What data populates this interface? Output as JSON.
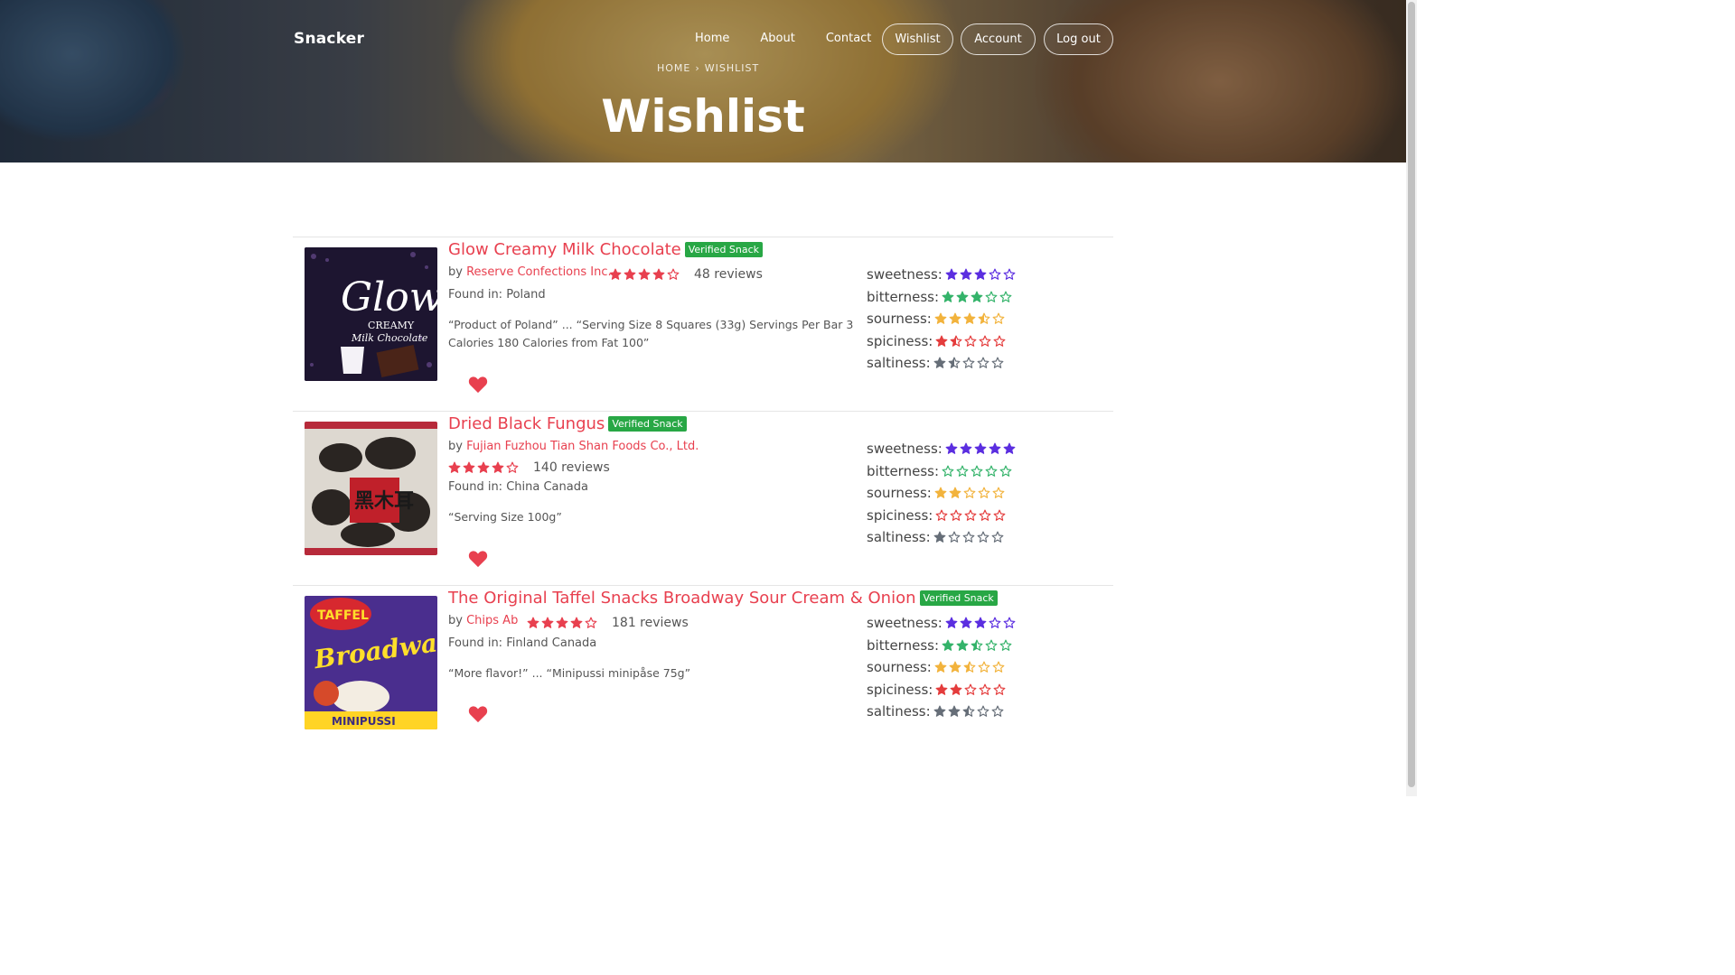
{
  "header": {
    "brand": "Snacker",
    "nav": [
      {
        "label": "Home"
      },
      {
        "label": "About"
      },
      {
        "label": "Contact"
      }
    ],
    "buttons": [
      {
        "label": "Wishlist"
      },
      {
        "label": "Account"
      },
      {
        "label": "Log out"
      }
    ],
    "breadcrumb": {
      "home": "HOME",
      "separator": "›",
      "current": "WISHLIST"
    },
    "title": "Wishlist"
  },
  "colors": {
    "accent": "#e8404f",
    "verified": "#28a745",
    "sweetness": "#5b2ee0",
    "bitterness": "#34b36a",
    "sourness": "#f2b33d",
    "spiciness": "#e43d3d",
    "saltiness": "#666e78"
  },
  "items": [
    {
      "title": "Glow Creamy Milk Chocolate",
      "badge": "Verified Snack",
      "by_prefix": "by",
      "maker": "Reserve Confections Inc.",
      "rating": 4,
      "reviews": "48 reviews",
      "found": "Found in: Poland",
      "description": "“Product of Poland” ... “Serving Size 8 Squares (33g) Servings Per Bar 3 Calories 180 Calories from Fat 100”",
      "heart_icon": "heart-icon",
      "attributes": [
        {
          "label": "sweetness:",
          "value": 3
        },
        {
          "label": "bitterness:",
          "value": 3
        },
        {
          "label": "sourness:",
          "value": 3.5
        },
        {
          "label": "spiciness:",
          "value": 1.5
        },
        {
          "label": "saltiness:",
          "value": 1.5
        }
      ]
    },
    {
      "title": "Dried Black Fungus",
      "badge": "Verified Snack",
      "by_prefix": "by",
      "maker": "Fujian Fuzhou Tian Shan Foods Co., Ltd.",
      "rating": 4,
      "reviews": "140 reviews",
      "found": "Found in: China Canada",
      "description": "“Serving Size 100g”",
      "heart_icon": "heart-icon",
      "attributes": [
        {
          "label": "sweetness:",
          "value": 5
        },
        {
          "label": "bitterness:",
          "value": 0
        },
        {
          "label": "sourness:",
          "value": 2
        },
        {
          "label": "spiciness:",
          "value": 0
        },
        {
          "label": "saltiness:",
          "value": 1
        }
      ]
    },
    {
      "title": "The Original Taffel Snacks Broadway Sour Cream & Onion",
      "badge": "Verified Snack",
      "by_prefix": "by",
      "maker": "Chips Ab",
      "rating": 4,
      "reviews": "181 reviews",
      "found": "Found in: Finland Canada",
      "description": "“More flavor!” ... “Minipussi minipåse 75g”",
      "heart_icon": "heart-icon",
      "attributes": [
        {
          "label": "sweetness:",
          "value": 3
        },
        {
          "label": "bitterness:",
          "value": 2.5
        },
        {
          "label": "sourness:",
          "value": 2.5
        },
        {
          "label": "spiciness:",
          "value": 2
        },
        {
          "label": "saltiness:",
          "value": 2.5
        }
      ]
    }
  ]
}
